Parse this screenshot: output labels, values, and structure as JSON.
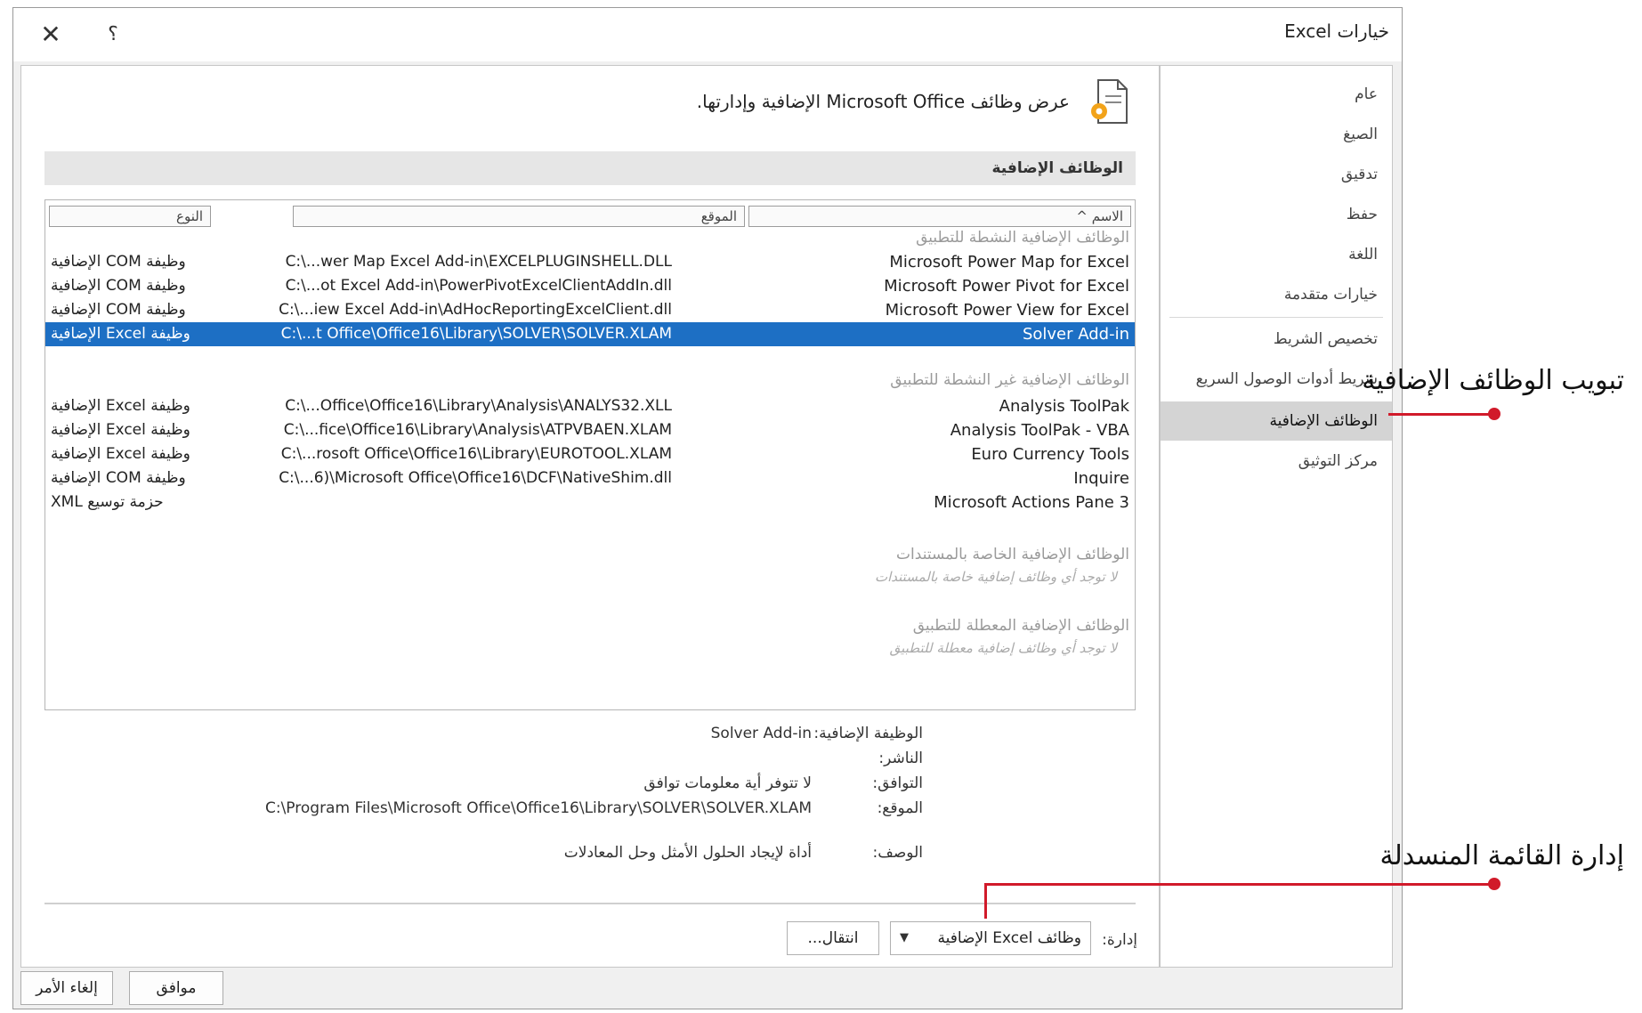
{
  "window": {
    "title": "خيارات Excel",
    "close_glyph": "✕",
    "help_glyph": "؟"
  },
  "nav": {
    "items": [
      {
        "label": "عام"
      },
      {
        "label": "الصيغ"
      },
      {
        "label": "تدقيق"
      },
      {
        "label": "حفظ"
      },
      {
        "label": "اللغة"
      },
      {
        "label": "خيارات متقدمة"
      },
      {
        "label": "تخصيص الشريط"
      },
      {
        "label": "شريط أدوات الوصول السريع"
      },
      {
        "label": "الوظائف الإضافية"
      },
      {
        "label": "مركز التوثيق"
      }
    ],
    "active_index": 8
  },
  "content": {
    "header_text": "عرض وظائف Microsoft Office الإضافية وإدارتها.",
    "section_title": "الوظائف الإضافية",
    "columns": {
      "name": "الاسم ^",
      "location": "الموقع",
      "type": "النوع"
    },
    "groups": {
      "active": "الوظائف الإضافية النشطة للتطبيق",
      "inactive": "الوظائف الإضافية غير النشطة للتطبيق",
      "document": "الوظائف الإضافية الخاصة بالمستندات",
      "document_empty": "لا توجد أي وظائف إضافية خاصة بالمستندات",
      "disabled": "الوظائف الإضافية المعطلة للتطبيق",
      "disabled_empty": "لا توجد أي وظائف إضافية معطلة للتطبيق"
    },
    "active_rows": [
      {
        "name": "Microsoft Power Map for Excel",
        "location": "C:\\...wer Map Excel Add-in\\EXCELPLUGINSHELL.DLL",
        "type": "وظيفة COM الإضافية"
      },
      {
        "name": "Microsoft Power Pivot for Excel",
        "location": "C:\\...ot Excel Add-in\\PowerPivotExcelClientAddIn.dll",
        "type": "وظيفة COM الإضافية"
      },
      {
        "name": "Microsoft Power View for Excel",
        "location": "C:\\...iew Excel Add-in\\AdHocReportingExcelClient.dll",
        "type": "وظيفة COM الإضافية"
      },
      {
        "name": "Solver Add-in",
        "location": "C:\\...t Office\\Office16\\Library\\SOLVER\\SOLVER.XLAM",
        "type": "وظيفة Excel الإضافية"
      }
    ],
    "inactive_rows": [
      {
        "name": "Analysis ToolPak",
        "location": "C:\\...Office\\Office16\\Library\\Analysis\\ANALYS32.XLL",
        "type": "وظيفة Excel الإضافية"
      },
      {
        "name": "Analysis ToolPak - VBA",
        "location": "C:\\...fice\\Office16\\Library\\Analysis\\ATPVBAEN.XLAM",
        "type": "وظيفة Excel الإضافية"
      },
      {
        "name": "Euro Currency Tools",
        "location": "C:\\...rosoft Office\\Office16\\Library\\EUROTOOL.XLAM",
        "type": "وظيفة Excel الإضافية"
      },
      {
        "name": "Inquire",
        "location": "C:\\...6)\\Microsoft Office\\Office16\\DCF\\NativeShim.dll",
        "type": "وظيفة COM الإضافية"
      },
      {
        "name": "Microsoft Actions Pane 3",
        "location": "",
        "type": "حزمة توسيع XML"
      }
    ],
    "selected_row": "Solver Add-in",
    "details": {
      "addin_label": "الوظيفة الإضافية:",
      "addin_value": "Solver Add-in",
      "publisher_label": "الناشر:",
      "publisher_value": "",
      "compat_label": "التوافق:",
      "compat_value": "لا تتوفر أية معلومات توافق",
      "location_label": "الموقع:",
      "location_value": "C:\\Program Files\\Microsoft Office\\Office16\\Library\\SOLVER\\SOLVER.XLAM",
      "desc_label": "الوصف:",
      "desc_value": "أداة لإيجاد الحلول الأمثل وحل المعادلات"
    },
    "manage": {
      "label": "إدارة:",
      "selected": "وظائف Excel الإضافية",
      "go_label": "انتقال..."
    }
  },
  "buttons": {
    "ok": "موافق",
    "cancel": "إلغاء الأمر"
  },
  "callouts": {
    "addins_tab": "تبويب الوظائف الإضافية",
    "manage_dropdown": "إدارة القائمة المنسدلة",
    "color": "#d11a2a"
  },
  "colors": {
    "selection": "#1d6fc4",
    "nav_active": "#d4d4d4"
  }
}
